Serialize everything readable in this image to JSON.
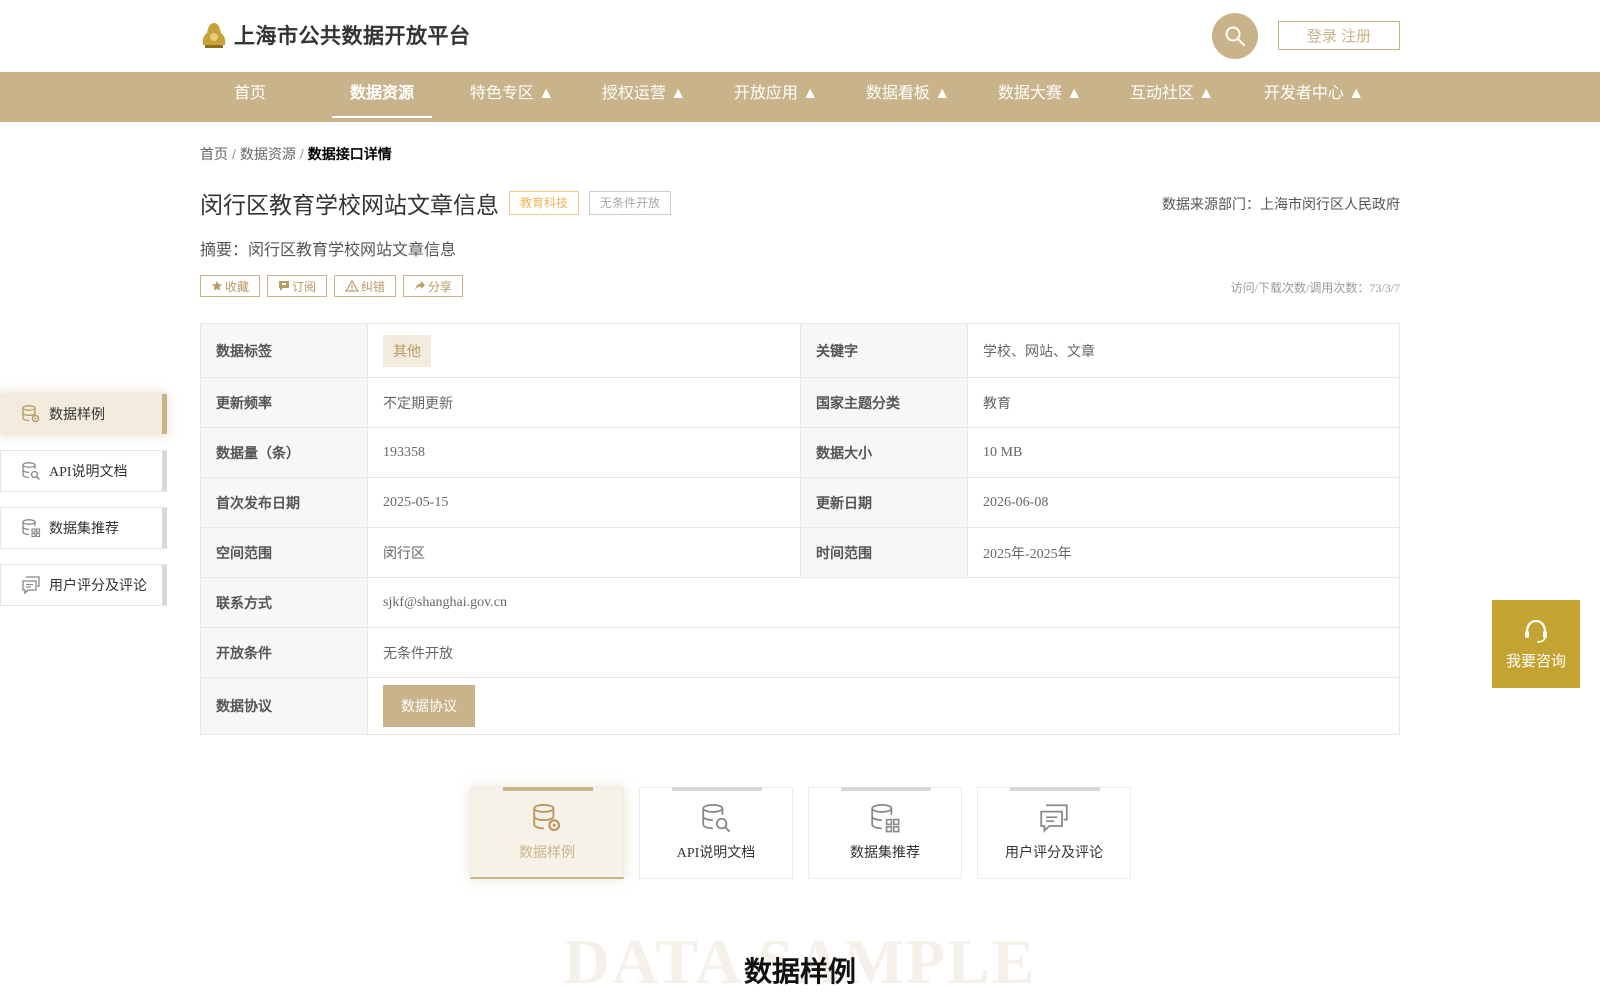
{
  "header": {
    "site_title": "上海市公共数据开放平台",
    "login_label": "登录 注册"
  },
  "nav": {
    "items": [
      {
        "label": "首页"
      },
      {
        "label": "数据资源"
      },
      {
        "label": "特色专区 ▲"
      },
      {
        "label": "授权运营 ▲"
      },
      {
        "label": "开放应用 ▲"
      },
      {
        "label": "数据看板 ▲"
      },
      {
        "label": "数据大赛 ▲"
      },
      {
        "label": "互动社区 ▲"
      },
      {
        "label": "开发者中心 ▲"
      }
    ],
    "active_index": 1
  },
  "breadcrumb": {
    "home": "首页",
    "sep": "/",
    "section": "数据资源",
    "current": "数据接口详情"
  },
  "dataset": {
    "title": "闵行区教育学校网站文章信息",
    "tag_category": "教育科技",
    "tag_open": "无条件开放",
    "source_dept": "数据来源部门：上海市闵行区人民政府",
    "summary": "摘要：闵行区教育学校网站文章信息",
    "stats": "访问/下载次数/调用次数：73/3/7"
  },
  "actions": {
    "favorite": "收藏",
    "subscribe": "订阅",
    "report": "纠错",
    "share": "分享"
  },
  "info": {
    "tag_label": "数据标签",
    "tag_value": "其他",
    "keyword_label": "关键字",
    "keyword_value": "学校、网站、文章",
    "freq_label": "更新频率",
    "freq_value": "不定期更新",
    "theme_label": "国家主题分类",
    "theme_value": "教育",
    "count_label": "数据量（条）",
    "count_value": "193358",
    "size_label": "数据大小",
    "size_value": "10 MB",
    "first_pub_label": "首次发布日期",
    "first_pub_value": "2025-05-15",
    "update_label": "更新日期",
    "update_value": "2026-06-08",
    "space_label": "空间范围",
    "space_value": "闵行区",
    "time_label": "时间范围",
    "time_value": "2025年-2025年",
    "contact_label": "联系方式",
    "contact_value": "sjkf@shanghai.gov.cn",
    "condition_label": "开放条件",
    "condition_value": "无条件开放",
    "protocol_label": "数据协议",
    "protocol_button": "数据协议"
  },
  "side_nav": {
    "items": [
      {
        "label": "数据样例"
      },
      {
        "label": "API说明文档"
      },
      {
        "label": "数据集推荐"
      },
      {
        "label": "用户评分及评论"
      }
    ],
    "active_index": 0
  },
  "consult": {
    "label": "我要咨询"
  },
  "tabs": {
    "items": [
      {
        "label": "数据样例"
      },
      {
        "label": "API说明文档"
      },
      {
        "label": "数据集推荐"
      },
      {
        "label": "用户评分及评论"
      }
    ],
    "active_index": 0
  },
  "section": {
    "bg_text": "DATA SAMPLE",
    "title": "数据样例"
  },
  "colors": {
    "brand": "#c9b38a",
    "consult": "#c4a332",
    "tag_orange": "#f5b35a"
  }
}
